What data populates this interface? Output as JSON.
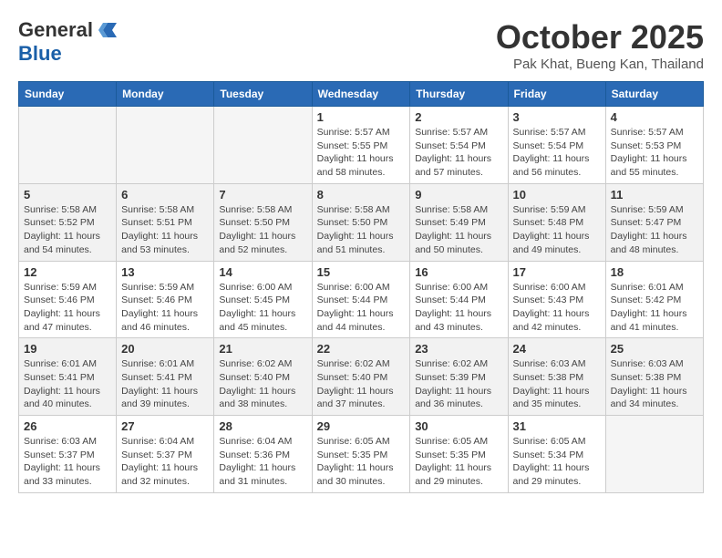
{
  "header": {
    "logo_general": "General",
    "logo_blue": "Blue",
    "month_title": "October 2025",
    "location": "Pak Khat, Bueng Kan, Thailand"
  },
  "weekdays": [
    "Sunday",
    "Monday",
    "Tuesday",
    "Wednesday",
    "Thursday",
    "Friday",
    "Saturday"
  ],
  "weeks": [
    [
      {
        "day": "",
        "info": ""
      },
      {
        "day": "",
        "info": ""
      },
      {
        "day": "",
        "info": ""
      },
      {
        "day": "1",
        "info": "Sunrise: 5:57 AM\nSunset: 5:55 PM\nDaylight: 11 hours\nand 58 minutes."
      },
      {
        "day": "2",
        "info": "Sunrise: 5:57 AM\nSunset: 5:54 PM\nDaylight: 11 hours\nand 57 minutes."
      },
      {
        "day": "3",
        "info": "Sunrise: 5:57 AM\nSunset: 5:54 PM\nDaylight: 11 hours\nand 56 minutes."
      },
      {
        "day": "4",
        "info": "Sunrise: 5:57 AM\nSunset: 5:53 PM\nDaylight: 11 hours\nand 55 minutes."
      }
    ],
    [
      {
        "day": "5",
        "info": "Sunrise: 5:58 AM\nSunset: 5:52 PM\nDaylight: 11 hours\nand 54 minutes."
      },
      {
        "day": "6",
        "info": "Sunrise: 5:58 AM\nSunset: 5:51 PM\nDaylight: 11 hours\nand 53 minutes."
      },
      {
        "day": "7",
        "info": "Sunrise: 5:58 AM\nSunset: 5:50 PM\nDaylight: 11 hours\nand 52 minutes."
      },
      {
        "day": "8",
        "info": "Sunrise: 5:58 AM\nSunset: 5:50 PM\nDaylight: 11 hours\nand 51 minutes."
      },
      {
        "day": "9",
        "info": "Sunrise: 5:58 AM\nSunset: 5:49 PM\nDaylight: 11 hours\nand 50 minutes."
      },
      {
        "day": "10",
        "info": "Sunrise: 5:59 AM\nSunset: 5:48 PM\nDaylight: 11 hours\nand 49 minutes."
      },
      {
        "day": "11",
        "info": "Sunrise: 5:59 AM\nSunset: 5:47 PM\nDaylight: 11 hours\nand 48 minutes."
      }
    ],
    [
      {
        "day": "12",
        "info": "Sunrise: 5:59 AM\nSunset: 5:46 PM\nDaylight: 11 hours\nand 47 minutes."
      },
      {
        "day": "13",
        "info": "Sunrise: 5:59 AM\nSunset: 5:46 PM\nDaylight: 11 hours\nand 46 minutes."
      },
      {
        "day": "14",
        "info": "Sunrise: 6:00 AM\nSunset: 5:45 PM\nDaylight: 11 hours\nand 45 minutes."
      },
      {
        "day": "15",
        "info": "Sunrise: 6:00 AM\nSunset: 5:44 PM\nDaylight: 11 hours\nand 44 minutes."
      },
      {
        "day": "16",
        "info": "Sunrise: 6:00 AM\nSunset: 5:44 PM\nDaylight: 11 hours\nand 43 minutes."
      },
      {
        "day": "17",
        "info": "Sunrise: 6:00 AM\nSunset: 5:43 PM\nDaylight: 11 hours\nand 42 minutes."
      },
      {
        "day": "18",
        "info": "Sunrise: 6:01 AM\nSunset: 5:42 PM\nDaylight: 11 hours\nand 41 minutes."
      }
    ],
    [
      {
        "day": "19",
        "info": "Sunrise: 6:01 AM\nSunset: 5:41 PM\nDaylight: 11 hours\nand 40 minutes."
      },
      {
        "day": "20",
        "info": "Sunrise: 6:01 AM\nSunset: 5:41 PM\nDaylight: 11 hours\nand 39 minutes."
      },
      {
        "day": "21",
        "info": "Sunrise: 6:02 AM\nSunset: 5:40 PM\nDaylight: 11 hours\nand 38 minutes."
      },
      {
        "day": "22",
        "info": "Sunrise: 6:02 AM\nSunset: 5:40 PM\nDaylight: 11 hours\nand 37 minutes."
      },
      {
        "day": "23",
        "info": "Sunrise: 6:02 AM\nSunset: 5:39 PM\nDaylight: 11 hours\nand 36 minutes."
      },
      {
        "day": "24",
        "info": "Sunrise: 6:03 AM\nSunset: 5:38 PM\nDaylight: 11 hours\nand 35 minutes."
      },
      {
        "day": "25",
        "info": "Sunrise: 6:03 AM\nSunset: 5:38 PM\nDaylight: 11 hours\nand 34 minutes."
      }
    ],
    [
      {
        "day": "26",
        "info": "Sunrise: 6:03 AM\nSunset: 5:37 PM\nDaylight: 11 hours\nand 33 minutes."
      },
      {
        "day": "27",
        "info": "Sunrise: 6:04 AM\nSunset: 5:37 PM\nDaylight: 11 hours\nand 32 minutes."
      },
      {
        "day": "28",
        "info": "Sunrise: 6:04 AM\nSunset: 5:36 PM\nDaylight: 11 hours\nand 31 minutes."
      },
      {
        "day": "29",
        "info": "Sunrise: 6:05 AM\nSunset: 5:35 PM\nDaylight: 11 hours\nand 30 minutes."
      },
      {
        "day": "30",
        "info": "Sunrise: 6:05 AM\nSunset: 5:35 PM\nDaylight: 11 hours\nand 29 minutes."
      },
      {
        "day": "31",
        "info": "Sunrise: 6:05 AM\nSunset: 5:34 PM\nDaylight: 11 hours\nand 29 minutes."
      },
      {
        "day": "",
        "info": ""
      }
    ]
  ]
}
